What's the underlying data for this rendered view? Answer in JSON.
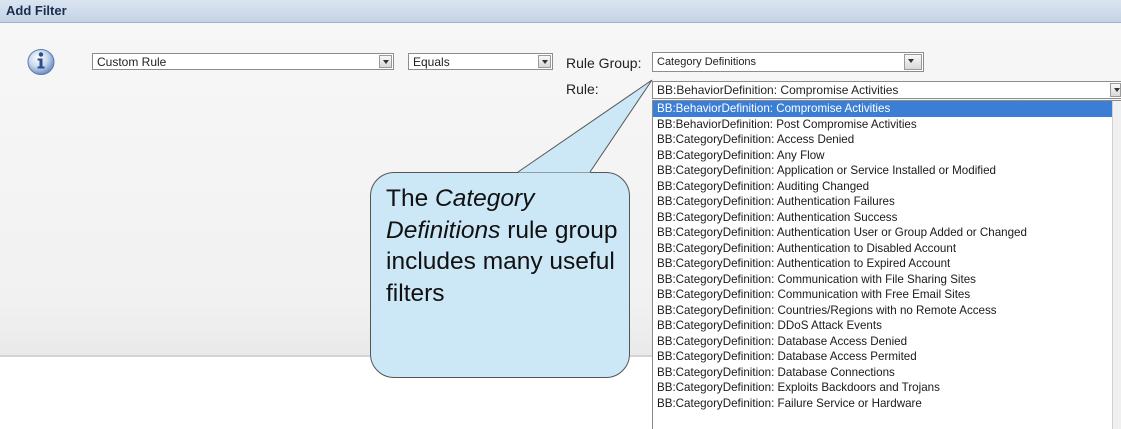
{
  "dialog": {
    "title": "Add Filter"
  },
  "filter": {
    "field_select": "Custom Rule",
    "operator_select": "Equals",
    "rule_group_label": "Rule Group:",
    "rule_group_value": "Category Definitions",
    "rule_label": "Rule:",
    "rule_value": "BB:BehaviorDefinition: Compromise Activities"
  },
  "rule_options": [
    "BB:BehaviorDefinition: Compromise Activities",
    "BB:BehaviorDefinition: Post Compromise Activities",
    "BB:CategoryDefinition: Access Denied",
    "BB:CategoryDefinition: Any Flow",
    "BB:CategoryDefinition: Application or Service Installed or Modified",
    "BB:CategoryDefinition: Auditing Changed",
    "BB:CategoryDefinition: Authentication Failures",
    "BB:CategoryDefinition: Authentication Success",
    "BB:CategoryDefinition: Authentication User or Group Added or Changed",
    "BB:CategoryDefinition: Authentication to Disabled Account",
    "BB:CategoryDefinition: Authentication to Expired Account",
    "BB:CategoryDefinition: Communication with File Sharing Sites",
    "BB:CategoryDefinition: Communication with Free Email Sites",
    "BB:CategoryDefinition: Countries/Regions with no Remote Access",
    "BB:CategoryDefinition: DDoS Attack Events",
    "BB:CategoryDefinition: Database Access Denied",
    "BB:CategoryDefinition: Database Access Permited",
    "BB:CategoryDefinition: Database Connections",
    "BB:CategoryDefinition: Exploits Backdoors and Trojans",
    "BB:CategoryDefinition: Failure Service or Hardware"
  ],
  "callout": {
    "part1": "The ",
    "emph1": "Category Definitions",
    "part2": " rule group includes many useful filters"
  },
  "colors": {
    "selection": "#3b7ed6",
    "callout_fill": "#cce7f6",
    "title_bar": "#c4d3e6"
  }
}
